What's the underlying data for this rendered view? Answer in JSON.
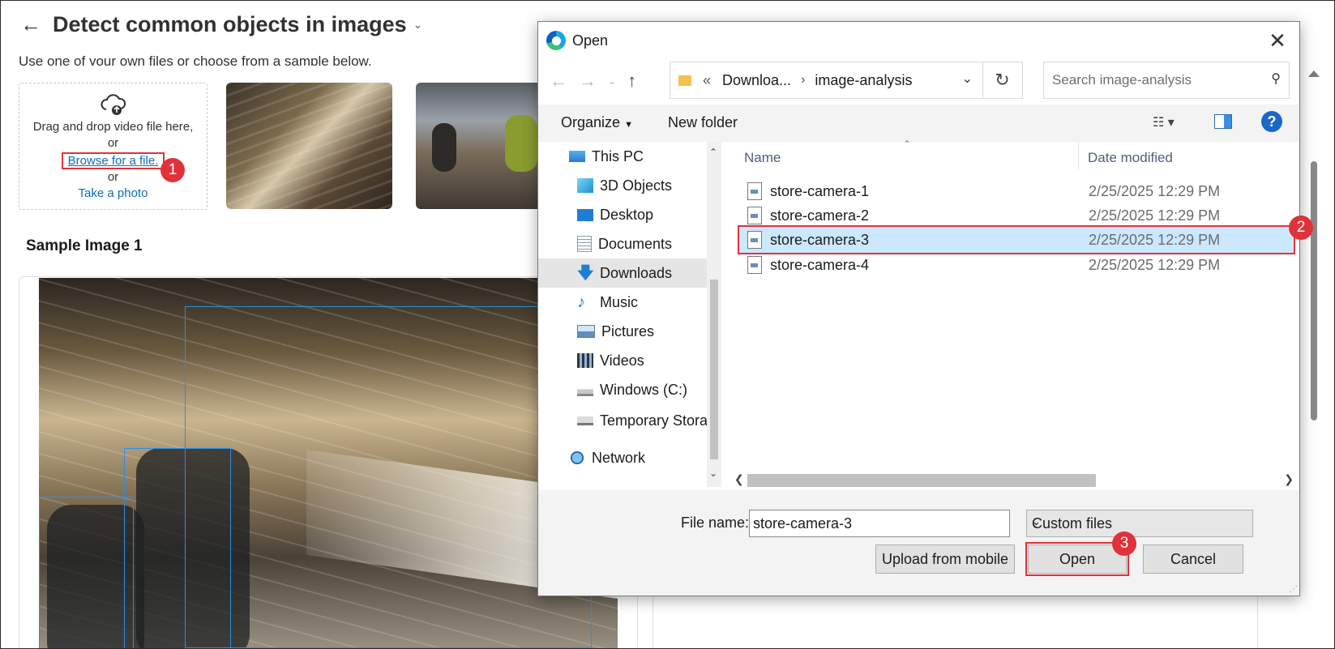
{
  "background": {
    "page_title": "Detect common objects in images",
    "subtitle": "Use one of your own files or choose from a sample below.",
    "dropzone": {
      "drag_text": "Drag and drop video file here,",
      "or1": "or",
      "browse_link": "Browse for a file.",
      "or2": "or",
      "photo_link": "Take a photo"
    },
    "sample_heading": "Sample Image 1"
  },
  "callouts": {
    "c1": "1",
    "c2": "2",
    "c3": "3"
  },
  "dialog": {
    "title": "Open",
    "address": {
      "parent": "Downloa...",
      "current": "image-analysis"
    },
    "search_placeholder": "Search image-analysis",
    "toolbar": {
      "organize": "Organize",
      "new_folder": "New folder"
    },
    "nav": [
      {
        "label": "This PC",
        "icon": "pc-icon"
      },
      {
        "label": "3D Objects",
        "icon": "3d-objects-icon"
      },
      {
        "label": "Desktop",
        "icon": "desktop-icon"
      },
      {
        "label": "Documents",
        "icon": "documents-icon"
      },
      {
        "label": "Downloads",
        "icon": "downloads-icon",
        "selected": true
      },
      {
        "label": "Music",
        "icon": "music-icon"
      },
      {
        "label": "Pictures",
        "icon": "pictures-icon"
      },
      {
        "label": "Videos",
        "icon": "videos-icon"
      },
      {
        "label": "Windows (C:)",
        "icon": "drive-icon"
      },
      {
        "label": "Temporary Stora",
        "icon": "drive-icon"
      },
      {
        "label": "Network",
        "icon": "network-icon"
      }
    ],
    "columns": {
      "name": "Name",
      "date": "Date modified"
    },
    "files": [
      {
        "name": "store-camera-1",
        "date": "2/25/2025 12:29 PM"
      },
      {
        "name": "store-camera-2",
        "date": "2/25/2025 12:29 PM"
      },
      {
        "name": "store-camera-3",
        "date": "2/25/2025 12:29 PM",
        "selected": true
      },
      {
        "name": "store-camera-4",
        "date": "2/25/2025 12:29 PM"
      }
    ],
    "file_name_label": "File name:",
    "file_name_value": "store-camera-3",
    "file_type": "Custom files",
    "buttons": {
      "upload": "Upload from mobile",
      "open": "Open",
      "cancel": "Cancel"
    }
  },
  "colors": {
    "accent": "#0f6cbd",
    "callout": "#e0323a",
    "selection": "#cce8ff"
  }
}
